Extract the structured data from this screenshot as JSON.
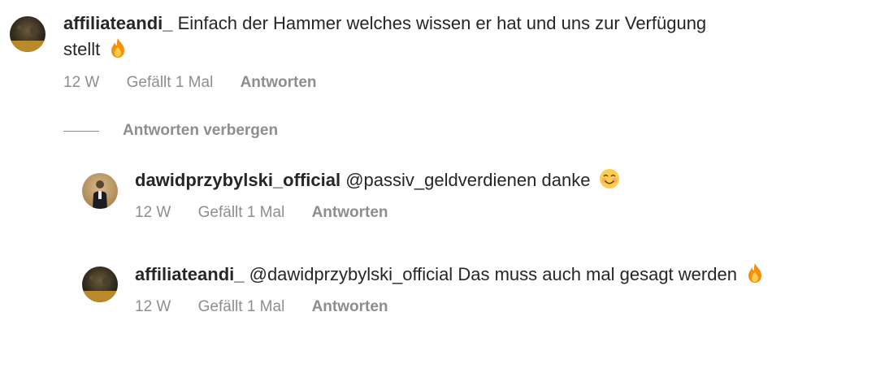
{
  "comments": [
    {
      "username": "affiliateandi_",
      "text_line1": "Einfach der Hammer welches wissen er hat und uns zur Verfügung",
      "text_line2": "stellt",
      "emoji": "fire-emoji",
      "time": "12 W",
      "likes": "Gefällt 1 Mal",
      "reply": "Antworten"
    }
  ],
  "hide_replies_label": "Antworten verbergen",
  "replies": [
    {
      "username": "dawidprzybylski_official",
      "mention": "@passiv_geldverdienen",
      "text": "danke",
      "emoji": "smiling-face-emoji",
      "time": "12 W",
      "likes": "Gefällt 1 Mal",
      "reply": "Antworten"
    },
    {
      "username": "affiliateandi_",
      "mention": "@dawidprzybylski_official",
      "text": "Das muss auch mal gesagt werden",
      "emoji": "fire-emoji",
      "time": "12 W",
      "likes": "Gefällt 1 Mal",
      "reply": "Antworten"
    }
  ],
  "colors": {
    "text": "#262626",
    "secondary": "#8e8e8e"
  }
}
